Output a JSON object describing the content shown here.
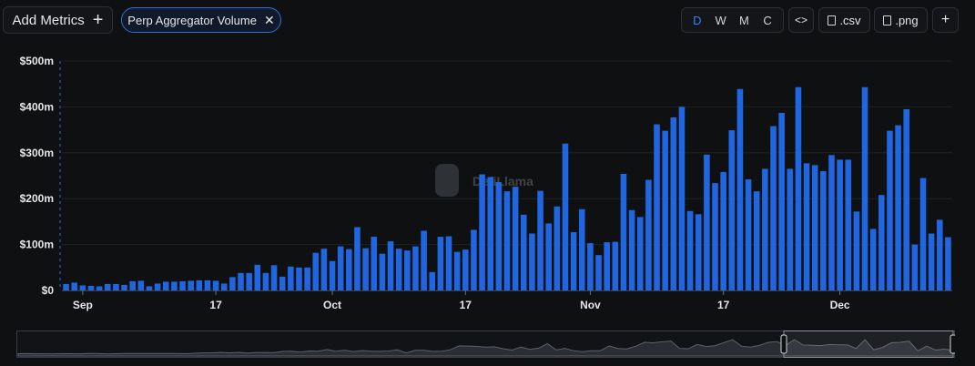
{
  "toolbar": {
    "add_metrics_label": "Add Metrics",
    "add_icon": "+",
    "metric_chip_label": "Perp Aggregator Volume",
    "chip_close_icon": "✕",
    "periods": [
      "D",
      "W",
      "M",
      "C"
    ],
    "active_period": "D",
    "embed_label": "<>",
    "csv_label": ".csv",
    "png_label": ".png",
    "more_icon": "+"
  },
  "colors": {
    "accent": "#3b82f6",
    "bar": "#1f66e0",
    "background": "#0f1012"
  },
  "watermark": "DefiLlama",
  "chart_data": {
    "type": "bar",
    "title": "",
    "xlabel": "",
    "ylabel": "",
    "y_tick_labels": [
      "$0",
      "$100m",
      "$200m",
      "$300m",
      "$400m",
      "$500m"
    ],
    "y_ticks": [
      0,
      100,
      200,
      300,
      400,
      500
    ],
    "ylim": [
      0,
      500
    ],
    "unit": "USD millions",
    "x_tick_labels": [
      {
        "label": "Sep",
        "date": "2024-09-01"
      },
      {
        "label": "17",
        "date": "2024-09-17"
      },
      {
        "label": "Oct",
        "date": "2024-10-01"
      },
      {
        "label": "17",
        "date": "2024-10-17"
      },
      {
        "label": "Nov",
        "date": "2024-11-01"
      },
      {
        "label": "17",
        "date": "2024-11-17"
      },
      {
        "label": "Dec",
        "date": "2024-12-01"
      }
    ],
    "start_date": "2024-08-30",
    "values": [
      14,
      17,
      11,
      10,
      9,
      14,
      14,
      12,
      20,
      21,
      9,
      15,
      19,
      19,
      20,
      21,
      22,
      22,
      21,
      15,
      29,
      38,
      38,
      56,
      38,
      55,
      30,
      52,
      50,
      50,
      82,
      91,
      64,
      96,
      90,
      138,
      92,
      117,
      80,
      107,
      91,
      87,
      96,
      130,
      40,
      117,
      118,
      84,
      89,
      132,
      253,
      247,
      236,
      216,
      226,
      165,
      124,
      217,
      146,
      183,
      320,
      127,
      177,
      103,
      77,
      105,
      106,
      254,
      175,
      160,
      241,
      362,
      348,
      377,
      400,
      173,
      166,
      296,
      234,
      258,
      349,
      439,
      242,
      216,
      265,
      358,
      387,
      265,
      443,
      277,
      273,
      260,
      295,
      285,
      285,
      172,
      443,
      134,
      208,
      348,
      360,
      395,
      100,
      245,
      124,
      154,
      116
    ],
    "navigator": {
      "window": [
        "2024-08-30",
        "2024-12-14"
      ]
    }
  }
}
